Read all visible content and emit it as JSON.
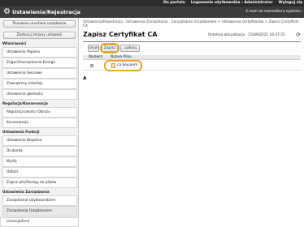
{
  "top_links": [
    "Do portalu",
    "Logowanie użytkownika : Administrator",
    "Wyloguj się"
  ],
  "header": {
    "title": "Ustawienia/Rejestracja",
    "email": "E-mail do menedżera systemu"
  },
  "sidebar": {
    "restart_button": "Ponownie uruchom urządzenie",
    "apply_button": "Zastosuj zmiany ustawień",
    "categories": {
      "preferences": "Właściwości",
      "adjustment": "Regulacja/Konserwacja",
      "functions": "Ustawienia Funkcji",
      "management": "Ustawienia Zarządzania"
    },
    "items": {
      "paper": "Ustawienia Papieru",
      "timer": "Zegar/Oszczędzanie Energii",
      "network": "Ustawienia Sieciowe",
      "external": "Zewnętrzny Interfejs",
      "volume": "Ustawienia głośności",
      "image_quality": "Regulacja Jakości Obrazu",
      "maintenance": "Konserwacja",
      "common": "Ustawienia Wspólne",
      "printer": "Drukarka",
      "send": "Wyślij",
      "receive": "Odbiór",
      "save_file": "Zapisz plik/Dostęp do plików",
      "user_mgmt": "Zarządzanie Użytkownikiem",
      "device_mgmt": "Zarządzanie Urządzeniem",
      "license": "Licencja/Inne"
    }
  },
  "main": {
    "breadcrumb": "Ustawienia/Rejestracja : Ustawienia Zarządzania : Zarządzanie Urządzeniem > Ustawienia certyfikatów > Zapisz Certyfikat CA",
    "title": "Zapisz Certyfikat CA",
    "last_update": "Ostatnia aktualizacja : 15/09/2021 16:37:25",
    "buttons": {
      "delete": "Usuń",
      "save": "Zapisz",
      "update": "...ualizuj..."
    },
    "table_headers": {
      "select": "Wybierz",
      "filename": "Nazwa Pliku"
    },
    "rows": [
      {
        "filename": "ca.key.pem"
      }
    ]
  }
}
